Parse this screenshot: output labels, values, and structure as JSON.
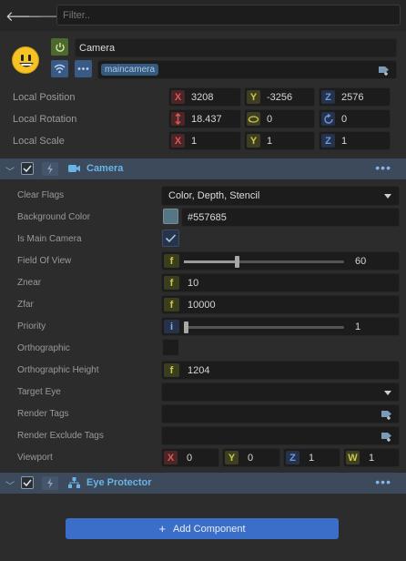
{
  "toolbar": {
    "filter_placeholder": "Filter.."
  },
  "node": {
    "name": "Camera",
    "layer_tag": "maincamera"
  },
  "transform": {
    "position": {
      "label": "Local Position",
      "x": "3208",
      "y": "-3256",
      "z": "2576"
    },
    "rotation": {
      "label": "Local Rotation",
      "x": "18.437",
      "y": "0",
      "z": "0"
    },
    "scale": {
      "label": "Local Scale",
      "x": "1",
      "y": "1",
      "z": "1"
    },
    "axis_x": "X",
    "axis_y": "Y",
    "axis_z": "Z"
  },
  "camera_section": {
    "title": "Camera",
    "clear_flags": {
      "label": "Clear Flags",
      "value": "Color, Depth, Stencil"
    },
    "background_color": {
      "label": "Background Color",
      "value": "#557685",
      "swatch": "#557685"
    },
    "is_main_camera": {
      "label": "Is Main Camera",
      "checked": true
    },
    "fov": {
      "label": "Field Of View",
      "prefix": "f",
      "value": "60",
      "slider_fraction": 0.33
    },
    "znear": {
      "label": "Znear",
      "prefix": "f",
      "value": "10"
    },
    "zfar": {
      "label": "Zfar",
      "prefix": "f",
      "value": "10000"
    },
    "priority": {
      "label": "Priority",
      "prefix": "i",
      "value": "1",
      "slider_fraction": 0.0
    },
    "orthographic": {
      "label": "Orthographic",
      "checked": false
    },
    "ortho_height": {
      "label": "Orthographic Height",
      "prefix": "f",
      "value": "1204"
    },
    "target_eye": {
      "label": "Target Eye",
      "value": ""
    },
    "render_tags": {
      "label": "Render Tags"
    },
    "render_exclude_tags": {
      "label": "Render Exclude Tags"
    },
    "viewport": {
      "label": "Viewport",
      "x_label": "X",
      "x": "0",
      "y_label": "Y",
      "y": "0",
      "z_label": "Z",
      "z": "1",
      "w_label": "W",
      "w": "1"
    }
  },
  "eye_section": {
    "title": "Eye Protector"
  },
  "add_component": {
    "label": "Add Component"
  },
  "colors": {
    "accent": "#3a6ec8",
    "section_bg": "#3c4a5c",
    "title_blue": "#68b4e6"
  }
}
